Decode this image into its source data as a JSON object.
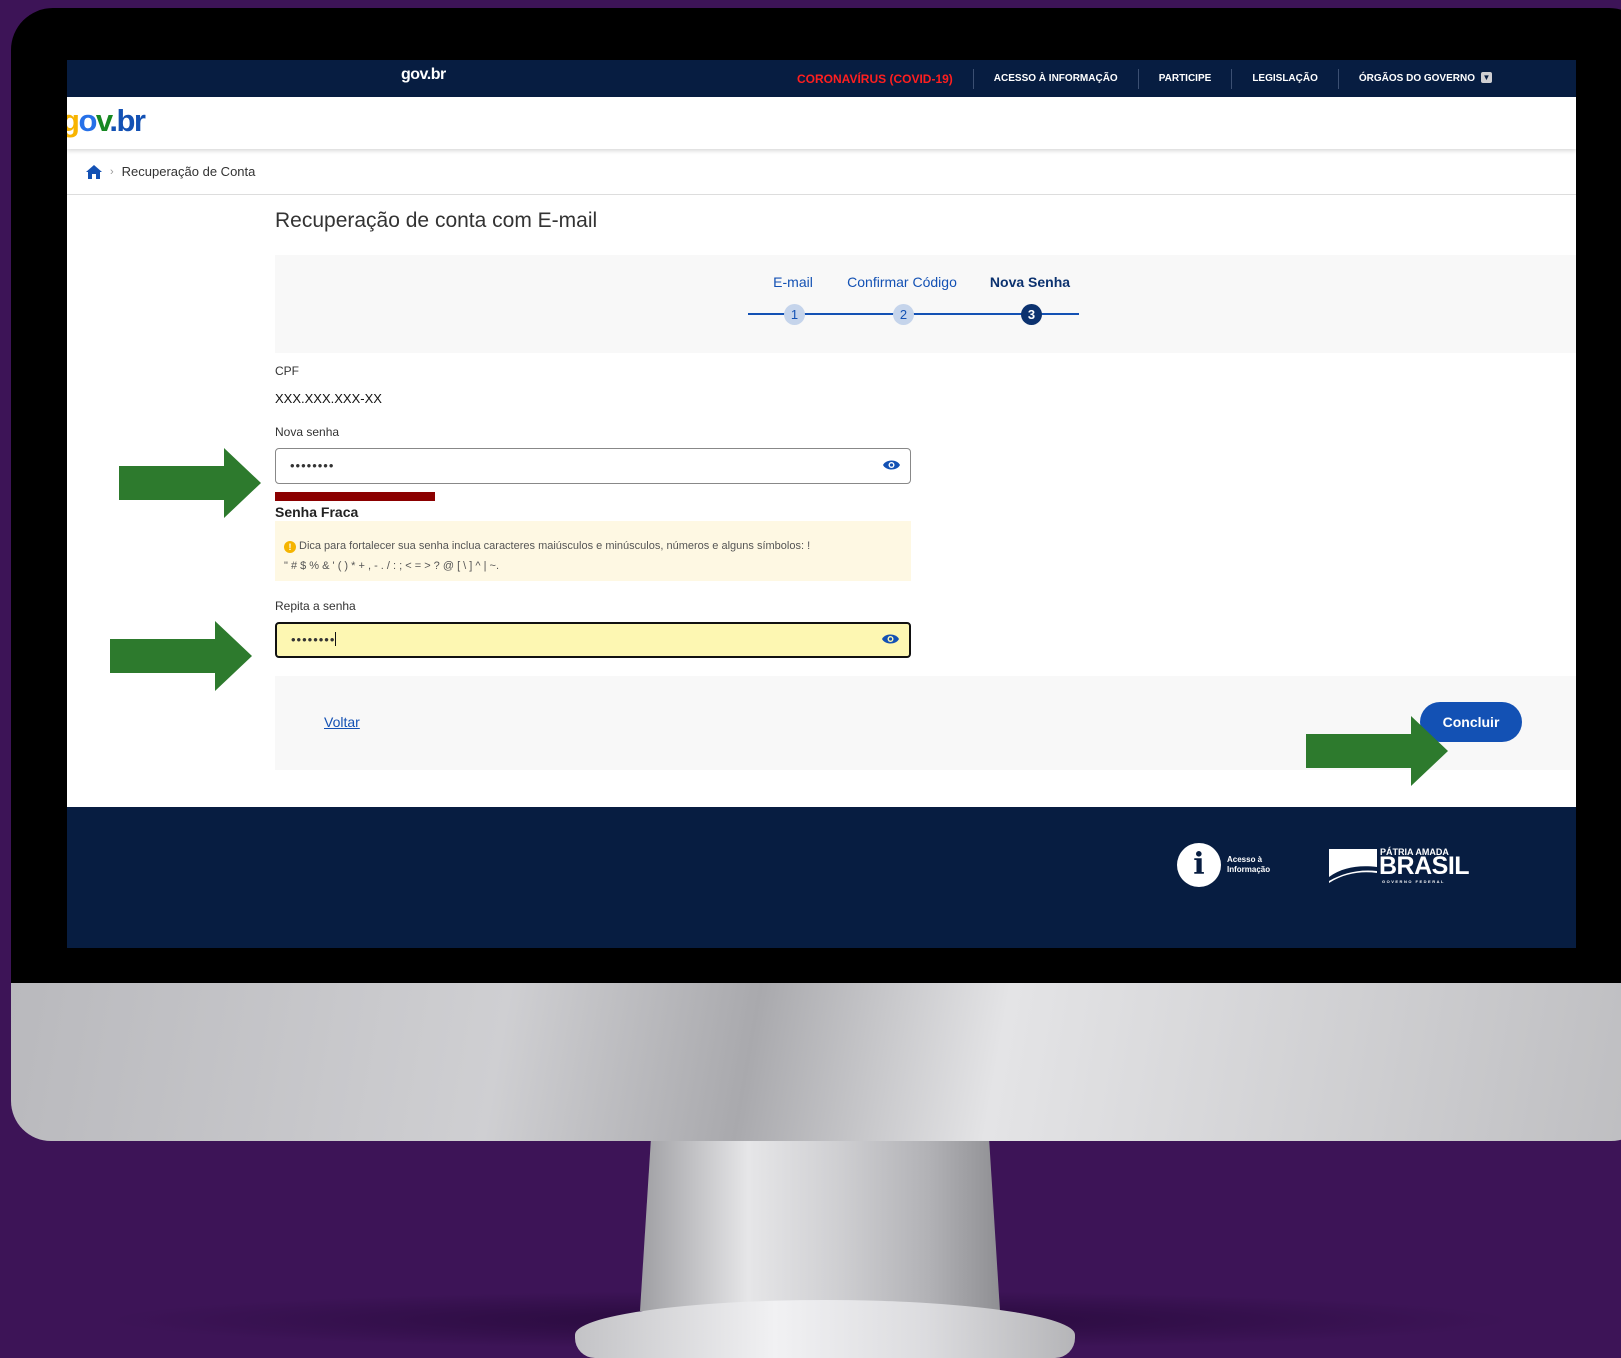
{
  "topbar": {
    "logo": "gov.br",
    "links": [
      {
        "label": "CORONAVÍRUS (COVID-19)"
      },
      {
        "label": "ACESSO À INFORMAÇÃO"
      },
      {
        "label": "PARTICIPE"
      },
      {
        "label": "LEGISLAÇÃO"
      },
      {
        "label": "ÓRGÃOS DO GOVERNO"
      }
    ],
    "covid_color": "#ff1f1f"
  },
  "header": {
    "logo_parts": [
      "g",
      "o",
      "v",
      ".",
      "br"
    ]
  },
  "breadcrumb": {
    "home_icon": "home-icon",
    "current": "Recuperação de Conta"
  },
  "page": {
    "title": "Recuperação de conta com E-mail"
  },
  "stepper": {
    "steps": [
      {
        "label": "E-mail",
        "number": "1",
        "state": "done"
      },
      {
        "label": "Confirmar Código",
        "number": "2",
        "state": "done"
      },
      {
        "label": "Nova Senha",
        "number": "3",
        "state": "current"
      }
    ]
  },
  "form": {
    "cpf_label": "CPF",
    "cpf_value": "XXX.XXX.XXX-XX",
    "new_password_label": "Nova senha",
    "new_password_value": "••••••••",
    "strength": {
      "label": "Senha Fraca",
      "color": "#8b0000",
      "level": 0.25
    },
    "tip_line1": "Dica para fortalecer sua senha inclua caracteres maiúsculos e minúsculos, números e alguns símbolos: !",
    "tip_line2": "\" # $ % & ' ( ) * + , - . / : ; < = > ? @ [ \\ ] ^ | ~.",
    "repeat_label": "Repita a senha",
    "repeat_value": "••••••••"
  },
  "actions": {
    "back_label": "Voltar",
    "submit_label": "Concluir"
  },
  "footer": {
    "info_glyph": "i",
    "info_line1": "Acesso à",
    "info_line2": "Informação",
    "brasil_top": "PÁTRIA AMADA",
    "brasil_main": "BRASIL",
    "brasil_sub": "GOVERNO FEDERAL"
  },
  "colors": {
    "primary": "#1351b4",
    "navy": "#071d41",
    "annotation_arrow": "#2d7a2d",
    "background": "#3d1457"
  }
}
